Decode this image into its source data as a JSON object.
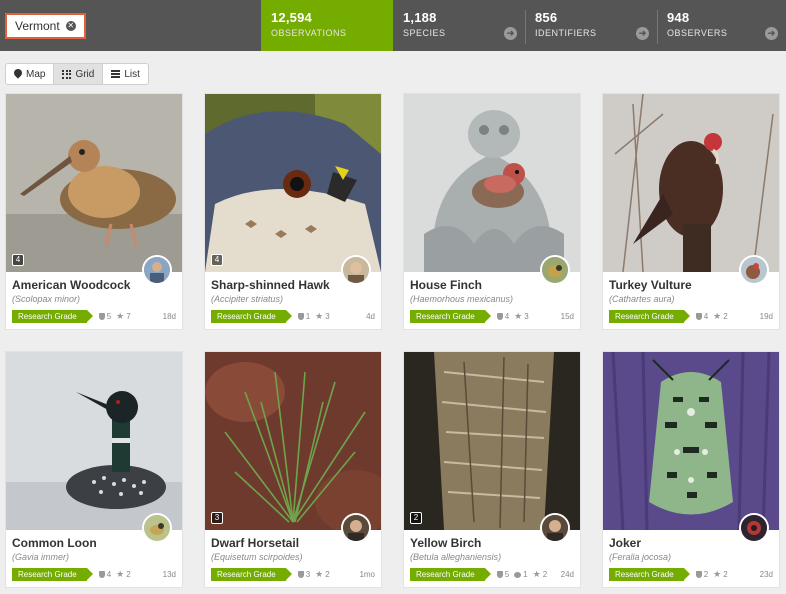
{
  "filter": {
    "place_label": "Vermont"
  },
  "stats": [
    {
      "value": "12,594",
      "label": "OBSERVATIONS"
    },
    {
      "value": "1,188",
      "label": "SPECIES"
    },
    {
      "value": "856",
      "label": "IDENTIFIERS"
    },
    {
      "value": "948",
      "label": "OBSERVERS"
    }
  ],
  "view_toggle": {
    "map": "Map",
    "grid": "Grid",
    "list": "List",
    "selected": "Grid"
  },
  "observations": [
    {
      "common_name": "American Woodcock",
      "scientific_name": "Scolopax minor",
      "quality": "Research Grade",
      "photo_count": "4",
      "ids": "5",
      "faves": "7",
      "age": "18d"
    },
    {
      "common_name": "Sharp-shinned Hawk",
      "scientific_name": "Accipiter striatus",
      "quality": "Research Grade",
      "photo_count": "4",
      "ids": "1",
      "faves": "3",
      "age": "4d"
    },
    {
      "common_name": "House Finch",
      "scientific_name": "Haemorhous mexicanus",
      "quality": "Research Grade",
      "ids": "4",
      "faves": "3",
      "age": "15d"
    },
    {
      "common_name": "Turkey Vulture",
      "scientific_name": "Cathartes aura",
      "quality": "Research Grade",
      "ids": "4",
      "faves": "2",
      "age": "19d"
    },
    {
      "common_name": "Common Loon",
      "scientific_name": "Gavia immer",
      "quality": "Research Grade",
      "ids": "4",
      "faves": "2",
      "age": "13d"
    },
    {
      "common_name": "Dwarf Horsetail",
      "scientific_name": "Equisetum scirpoides",
      "quality": "Research Grade",
      "photo_count": "3",
      "ids": "3",
      "faves": "2",
      "age": "1mo"
    },
    {
      "common_name": "Yellow Birch",
      "scientific_name": "Betula alleghaniensis",
      "quality": "Research Grade",
      "photo_count": "2",
      "ids": "5",
      "comments": "1",
      "faves": "2",
      "age": "24d"
    },
    {
      "common_name": "Joker",
      "scientific_name": "Feralia jocosa",
      "quality": "Research Grade",
      "ids": "2",
      "faves": "2",
      "age": "23d"
    }
  ],
  "colors": {
    "accent": "#74ac00",
    "topbar": "#555555",
    "highlight": "#e0603a"
  }
}
